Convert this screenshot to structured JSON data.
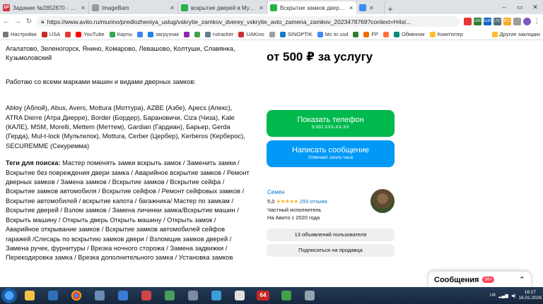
{
  "tabs": [
    {
      "label": "Задание №2852870 - просмотр з",
      "fav": "SP",
      "color": "#cc3344"
    },
    {
      "label": "ImageBam",
      "fav": "",
      "color": "#999999"
    },
    {
      "label": "вскрытие дверей в Мурино - цен",
      "fav": "",
      "color": "#26b24b"
    },
    {
      "label": "Вскрытие замков дверей Вскрыт",
      "fav": "",
      "color": "#26b24b",
      "active": true
    },
    {
      "label": "",
      "fav": "",
      "color": "#3f8cf0"
    }
  ],
  "window": {
    "min": "–",
    "max": "▭",
    "close": "✕"
  },
  "address": {
    "url": "https://www.avito.ru/murino/predlozheniya_uslug/vskrytie_zamkov_dverey_vskrytie_avto_zamena_zamkov_2023478769?context=H4sI..."
  },
  "extensions": [
    "USD",
    "EUR",
    "LTC",
    "BTC"
  ],
  "bookmarks": [
    "Настройки",
    "USA",
    "",
    "YouTube",
    "Карты",
    "",
    "загрузчик",
    "",
    "",
    "rutracker",
    "UAKino",
    "",
    "SINOPTIK",
    "btc to usd",
    "",
    "FP",
    "",
    "Обмінник",
    "Комп'ютер",
    ""
  ],
  "bookmarks_right": "Другие закладки",
  "content": {
    "cities": "Агалатово, Зеленогорск, Янино, Комарово, Левашово, Колтуши, Славянка, Кузьмоловский",
    "brands_intro": "Работаю со всеми марками машин и видами дверных замков:",
    "brands": "Abloy (Аблой), Abus, Avers, Mottura (Моттура), AZBE (Азбе), Apecs (Апекс), ATRA Dierre (Атра Диерре), Border (Бордер), Барановичи, Ciza (Чиза), Kale (КАЛЕ), MSM, Morelli, Mettem (Меттем), Gardian (Гардиан), Барьер, Gerda (Герда), Mul-t-lock (Мультилок), Mottura, Cerber (Цербер), Kerberos (Керберос), SECUREMME (Секуремма)",
    "tags_label": "Теги для поиска:",
    "tags": "Мастер поменять замки вскрыть замок / Заменить замки / Вскрытие без повреждения двери замка / Аварийное вскрытие замков / Ремонт дверных замков / Замена замков / Вскрытие замков / Вскрытие сейфа / Вскрытие замков автомобиля / Вскрытие сейфов / Ремонт сейфовых замков / Вскрытие автомобилей / вскрытие капота / багажника/ Мастер по замкам / Вскрытие дверей / Взлом замков / Замена личинки замка/Вскрытие машин / Вскрыть машину / Открыть дверь Открыть машину / Открыть замок / Аварийное открывание замков / Вскрытие замков автомобилей сейфов гаражей /Слесарь по вскрытию замков двери / Взломщик замков дверей / Замена ручек, фурнитуры / Врезка ночного сторожа / Замена задвижки / Перекодировка замка / Врезка дополнительного замка / Установка замков"
  },
  "sidebar": {
    "price": "от 500 ₽ за услугу",
    "phone_label": "Показать телефон",
    "phone_number": "8 932 XXX-XX-XX",
    "message_label": "Написать сообщение",
    "message_sub": "Отвечает около часа",
    "seller_name": "Семён",
    "rating": "5,0",
    "stars": "★★★★★",
    "reviews": "293 отзыва",
    "seller_type": "Частный исполнитель",
    "seller_since": "На Авито с 2020 года",
    "ads_count": "13 объявлений пользователя",
    "subscribe": "Подписаться на продавца"
  },
  "messages_bar": {
    "label": "Сообщения",
    "badge": "99+"
  },
  "taskbar": {
    "items": [
      "",
      "",
      "",
      "",
      "",
      "",
      "",
      "",
      "",
      "",
      "64",
      "",
      ""
    ],
    "lang": "UK",
    "time": "16:27",
    "date": "16.01.2026"
  }
}
